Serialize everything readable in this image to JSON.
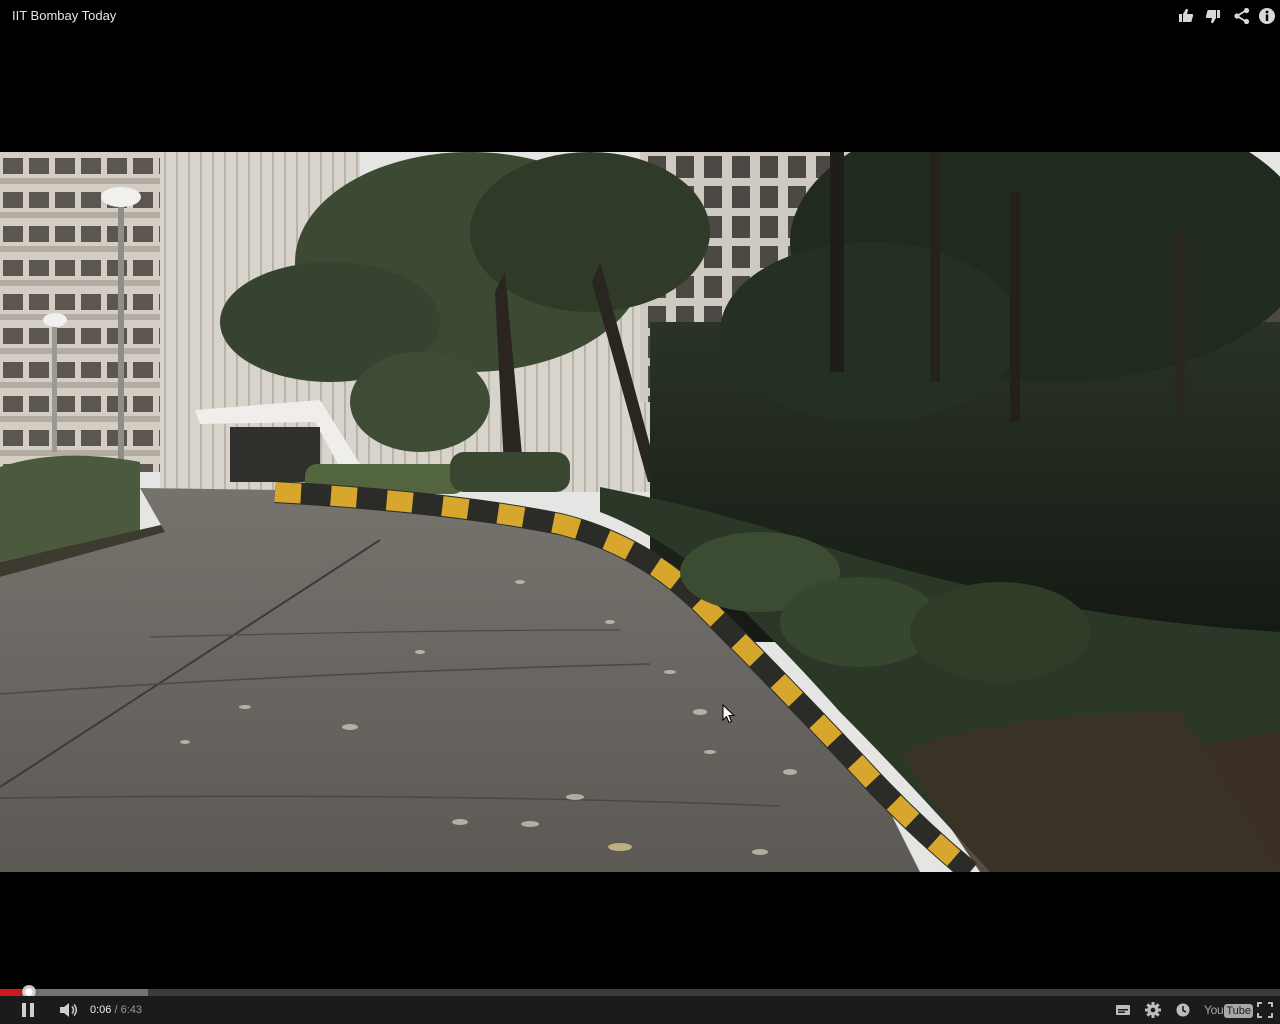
{
  "video": {
    "title": "IIT Bombay Today"
  },
  "top_actions": {
    "like_icon": "thumbs-up-icon",
    "dislike_icon": "thumbs-down-icon",
    "share_icon": "share-icon",
    "info_icon": "info-icon"
  },
  "playback": {
    "current_time": "0:06",
    "separator": " / ",
    "duration": "6:43",
    "played_fraction": 0.0227,
    "buffered_fraction": 0.116,
    "state": "playing"
  },
  "controls": {
    "play_pause_icon": "pause-icon",
    "volume_icon": "volume-icon",
    "captions_icon": "captions-icon",
    "settings_icon": "gear-icon",
    "watch_later_icon": "clock-icon",
    "fullscreen_icon": "fullscreen-icon",
    "logo_you": "You",
    "logo_tube": "Tube"
  },
  "colors": {
    "progress_played": "#cc181e",
    "progress_loaded": "#737373",
    "progress_track": "#3b3b3b",
    "control_bar": "#1b1b1b",
    "icon": "#cfcfcf"
  }
}
